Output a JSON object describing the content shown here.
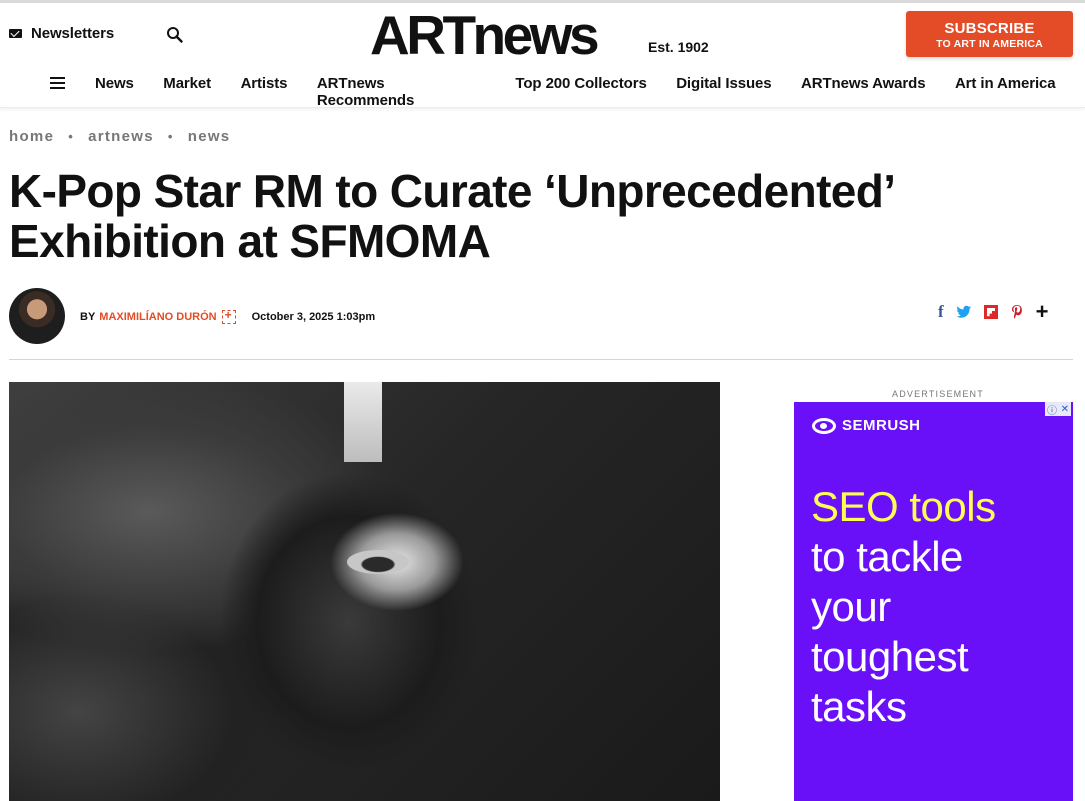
{
  "header": {
    "newsletters_label": "Newsletters",
    "logo": "ARTnews",
    "est": "Est. 1902",
    "subscribe_line1": "SUBSCRIBE",
    "subscribe_line2": "TO ART IN AMERICA"
  },
  "nav": {
    "items": [
      {
        "label": "News"
      },
      {
        "label": "Market"
      },
      {
        "label": "Artists"
      },
      {
        "label": "ARTnews Recommends"
      },
      {
        "label": "Top 200 Collectors"
      },
      {
        "label": "Digital Issues"
      },
      {
        "label": "ARTnews Awards"
      },
      {
        "label": "Art in America"
      }
    ]
  },
  "breadcrumb": [
    "home",
    "artnews",
    "news"
  ],
  "article": {
    "title": "K-Pop Star RM to Curate ‘Unprecedented’ Exhibition at SFMOMA",
    "by": "BY",
    "author": "MAXIMILÍANO DURÓN",
    "date": "October 3, 2025 1:03pm"
  },
  "share": {
    "facebook": "f",
    "twitter": "t",
    "flipboard": "F",
    "pinterest": "p",
    "more": "+"
  },
  "ad": {
    "label": "ADVERTISEMENT",
    "brand": "SEMRUSH",
    "headline_highlight": "SEO tools",
    "headline_lines": [
      "to tackle",
      "your",
      "toughest",
      "tasks"
    ]
  },
  "colors": {
    "accent": "#e34c26",
    "ad_bg": "#6a10f8",
    "ad_highlight": "#fffd53",
    "facebook": "#3b5998",
    "twitter": "#1da1f2",
    "flipboard": "#e12828",
    "pinterest": "#cb2027"
  },
  "icons": {
    "newsletters": "mail-icon",
    "search": "search-icon",
    "menu": "hamburger-icon"
  }
}
